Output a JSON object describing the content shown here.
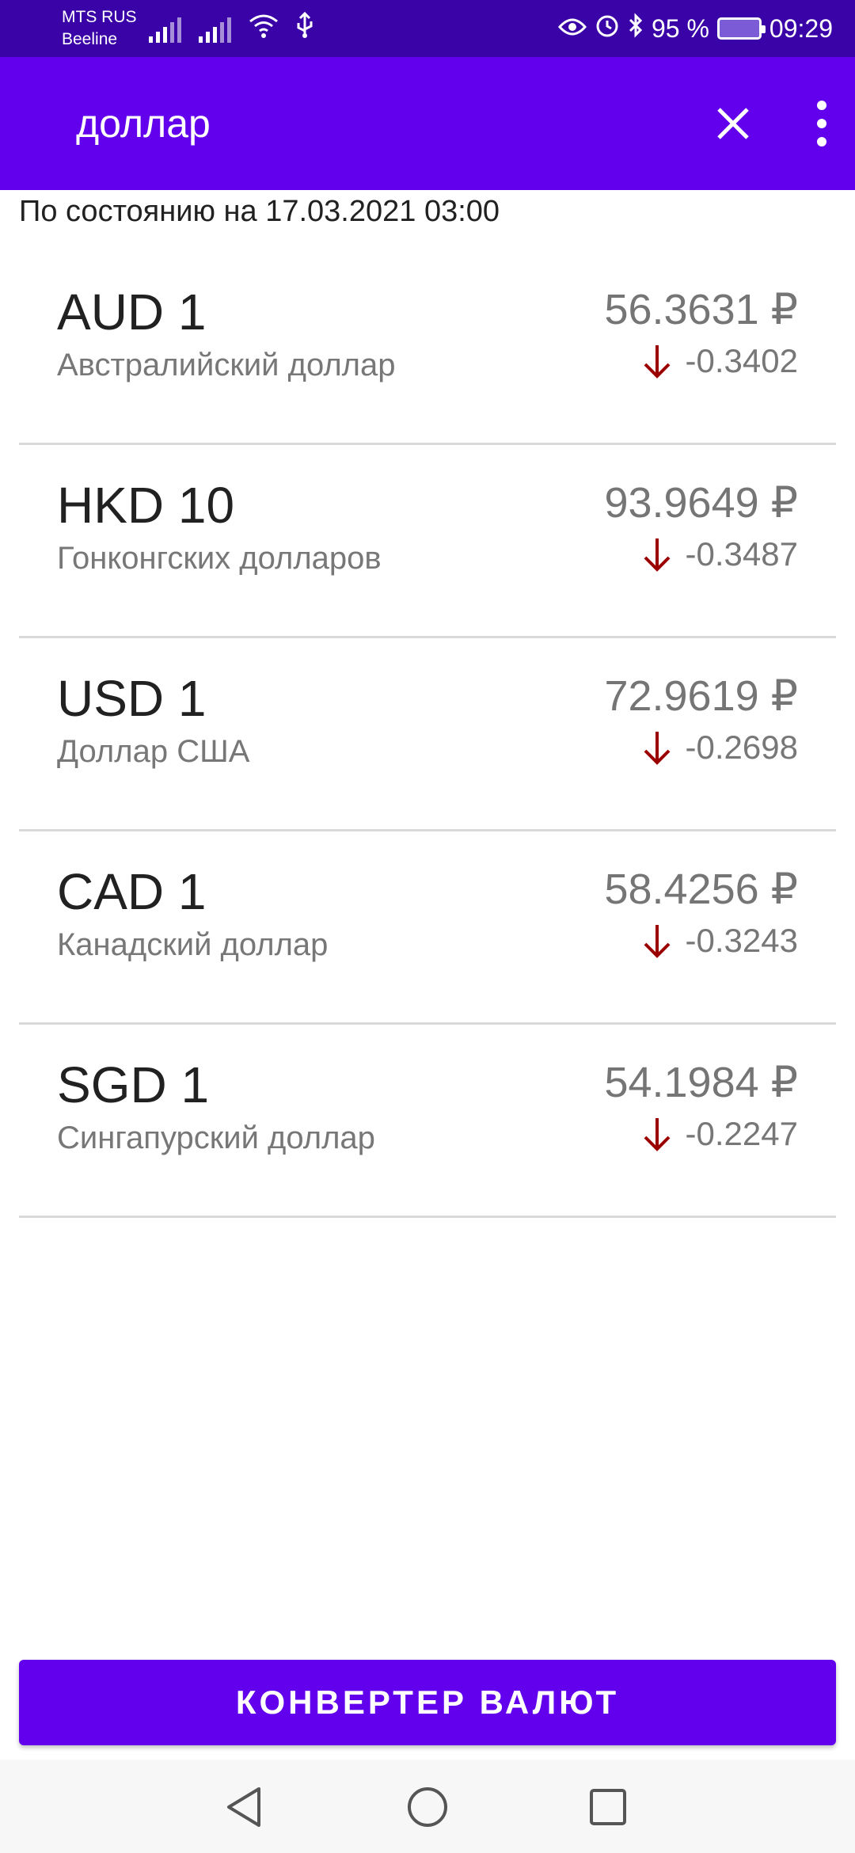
{
  "status_bar": {
    "carrier_1": "MTS RUS",
    "carrier_2": "Beeline",
    "battery": "95 %",
    "time": "09:29",
    "icons": [
      "signal-icon",
      "signal-icon",
      "wifi-icon",
      "usb-icon",
      "eye-icon",
      "alarm-icon",
      "bluetooth-icon",
      "battery-charging-icon"
    ]
  },
  "app_bar": {
    "search_query": "доллар",
    "close_icon": "close-icon",
    "menu_icon": "more-vert-icon",
    "background": "#6200ee"
  },
  "date_line": "По состоянию на 17.03.2021 03:00",
  "currencies": [
    {
      "code": "AUD 1",
      "name": "Австралийский доллар",
      "rate": "56.3631 ₽",
      "change": "-0.3402",
      "trend": "down"
    },
    {
      "code": "HKD 10",
      "name": "Гонконгских долларов",
      "rate": "93.9649 ₽",
      "change": "-0.3487",
      "trend": "down"
    },
    {
      "code": "USD 1",
      "name": "Доллар США",
      "rate": "72.9619 ₽",
      "change": "-0.2698",
      "trend": "down"
    },
    {
      "code": "CAD 1",
      "name": "Канадский доллар",
      "rate": "58.4256 ₽",
      "change": "-0.3243",
      "trend": "down"
    },
    {
      "code": "SGD 1",
      "name": "Сингапурский доллар",
      "rate": "54.1984 ₽",
      "change": "-0.2247",
      "trend": "down"
    }
  ],
  "colors": {
    "accent": "#6200ee",
    "status_bar": "#3a03a8",
    "down_arrow": "#9b0000"
  },
  "convert_button": "КОНВЕРТЕР ВАЛЮТ",
  "nav_bar": {
    "icons": [
      "back-icon",
      "home-icon",
      "recents-icon"
    ]
  }
}
